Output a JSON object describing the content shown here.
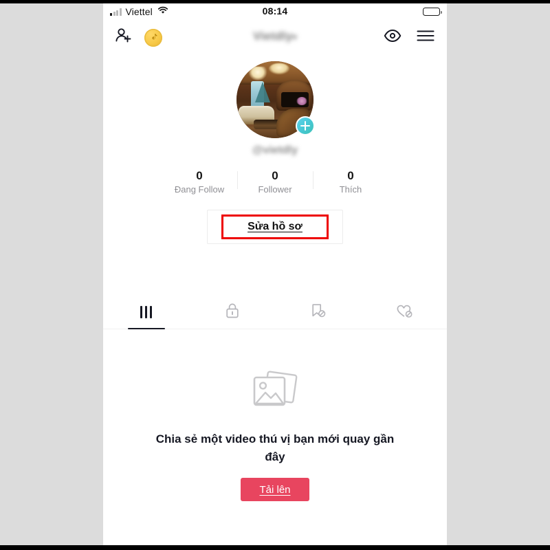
{
  "status_bar": {
    "carrier": "Viettel",
    "time": "08:14",
    "signal_icon": "cellular-signal-icon",
    "wifi_icon": "wifi-icon",
    "battery_icon": "battery-icon"
  },
  "nav_bar": {
    "add_friend_icon": "add-person-icon",
    "coin_icon": "tiktok-coin-icon",
    "title": "Vietdly",
    "title_chevron": "▾",
    "eye_icon": "eye-icon",
    "menu_icon": "hamburger-menu-icon"
  },
  "profile": {
    "avatar_alt": "profile-photo-living-room",
    "add_avatar_badge": "plus-icon",
    "handle": "@vietdly",
    "stats": [
      {
        "value": "0",
        "label": "Đang Follow"
      },
      {
        "value": "0",
        "label": "Follower"
      },
      {
        "value": "0",
        "label": "Thích"
      }
    ],
    "edit_button_label": "Sửa hồ sơ"
  },
  "annotation": {
    "color": "#ee0000",
    "target": "edit-profile-button"
  },
  "tabs": [
    {
      "name": "tab-videos",
      "icon": "grid-icon",
      "active": true
    },
    {
      "name": "tab-private",
      "icon": "lock-icon",
      "active": false
    },
    {
      "name": "tab-saved",
      "icon": "bookmark-hidden-icon",
      "active": false
    },
    {
      "name": "tab-liked",
      "icon": "heart-hidden-icon",
      "active": false
    }
  ],
  "empty_state": {
    "icon": "photo-stack-icon",
    "message": "Chia sẻ một video thú vị bạn mới quay gần đây",
    "upload_label": "Tải lên",
    "upload_color": "#e8455f"
  }
}
